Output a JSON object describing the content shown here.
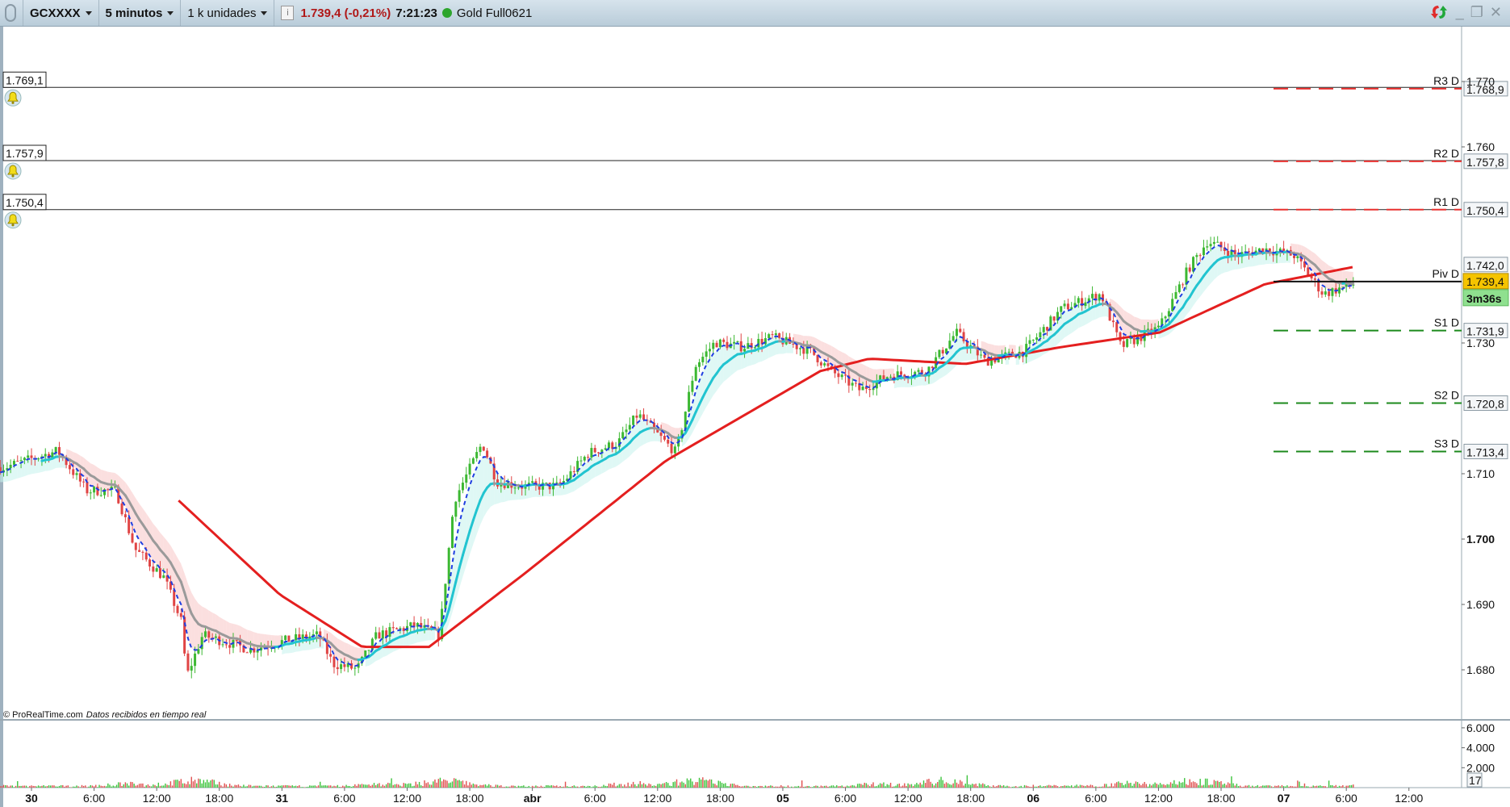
{
  "topbar": {
    "symbol": "GCXXXX",
    "timeframe": "5 minutos",
    "units": "1 k unidades",
    "info_icon": "i",
    "last_price": "1.739,4 (-0,21%)",
    "time": "7:21:23",
    "instrument": "Gold Full0621",
    "status_color": "#2da52d"
  },
  "window_controls": {
    "minimize": "_",
    "restore": "❐",
    "close": "✕"
  },
  "credit": {
    "source": "© ProRealTime.com",
    "note": "Datos recibidos en tiempo real"
  },
  "alerts": [
    {
      "label": "1.769,1",
      "price": 1769.1
    },
    {
      "label": "1.757,9",
      "price": 1757.9
    },
    {
      "label": "1.750,4",
      "price": 1750.4
    }
  ],
  "pivots": [
    {
      "name": "R3 D",
      "label": "1.768,9",
      "price": 1768.9,
      "color": "#e8312f",
      "style": "dash"
    },
    {
      "name": "R2 D",
      "label": "1.757,8",
      "price": 1757.8,
      "color": "#e8312f",
      "style": "dash"
    },
    {
      "name": "R1 D",
      "label": "1.750,4",
      "price": 1750.4,
      "color": "#e8312f",
      "style": "dash"
    },
    {
      "name": "Piv D",
      "label": "",
      "price": 1739.4,
      "color": "#111111",
      "style": "solid"
    },
    {
      "name": "S1 D",
      "label": "1.731,9",
      "price": 1731.9,
      "color": "#1c8a1c",
      "style": "dash"
    },
    {
      "name": "S2 D",
      "label": "1.720,8",
      "price": 1720.8,
      "color": "#1c8a1c",
      "style": "dash"
    },
    {
      "name": "S3 D",
      "label": "1.713,4",
      "price": 1713.4,
      "color": "#1c8a1c",
      "style": "dash"
    }
  ],
  "price_tags": {
    "ma_value": "1.742,0",
    "ma_price": 1742.0,
    "last": "1.739,4",
    "last_price": 1739.4,
    "countdown": "3m36s"
  },
  "price_axis": [
    {
      "label": "1.770",
      "value": 1770,
      "bold": false
    },
    {
      "label": "1.760",
      "value": 1760,
      "bold": false
    },
    {
      "label": "1.730",
      "value": 1730,
      "bold": false
    },
    {
      "label": "1.710",
      "value": 1710,
      "bold": false
    },
    {
      "label": "1.700",
      "value": 1700,
      "bold": true
    },
    {
      "label": "1.690",
      "value": 1690,
      "bold": false
    },
    {
      "label": "1.680",
      "value": 1680,
      "bold": false
    }
  ],
  "volume_axis": [
    {
      "label": "6.000",
      "value": 6000
    },
    {
      "label": "4.000",
      "value": 4000
    },
    {
      "label": "2.000",
      "value": 2000
    }
  ],
  "volume_last": "17",
  "time_axis": [
    {
      "label": "30",
      "hour": 0,
      "bold": true
    },
    {
      "label": "6:00",
      "hour": 6
    },
    {
      "label": "12:00",
      "hour": 12
    },
    {
      "label": "18:00",
      "hour": 18
    },
    {
      "label": "31",
      "hour": 24,
      "bold": true
    },
    {
      "label": "6:00",
      "hour": 30
    },
    {
      "label": "12:00",
      "hour": 36
    },
    {
      "label": "18:00",
      "hour": 42
    },
    {
      "label": "abr",
      "hour": 48,
      "bold": true
    },
    {
      "label": "6:00",
      "hour": 54
    },
    {
      "label": "12:00",
      "hour": 60
    },
    {
      "label": "18:00",
      "hour": 66
    },
    {
      "label": "05",
      "hour": 72,
      "bold": true
    },
    {
      "label": "6:00",
      "hour": 78
    },
    {
      "label": "12:00",
      "hour": 84
    },
    {
      "label": "18:00",
      "hour": 90
    },
    {
      "label": "06",
      "hour": 96,
      "bold": true
    },
    {
      "label": "6:00",
      "hour": 102
    },
    {
      "label": "12:00",
      "hour": 108
    },
    {
      "label": "18:00",
      "hour": 114
    },
    {
      "label": "07",
      "hour": 120,
      "bold": true
    },
    {
      "label": "6:00",
      "hour": 126
    },
    {
      "label": "12:00",
      "hour": 132
    }
  ],
  "chart_data": {
    "type": "candlestick",
    "price_path": [
      [
        -2.6,
        1711.0
      ],
      [
        2.5,
        1713.5
      ],
      [
        5.3,
        1707.4
      ],
      [
        8.1,
        1707.4
      ],
      [
        9.9,
        1698.5
      ],
      [
        12.7,
        1694.1
      ],
      [
        14.5,
        1686.8
      ],
      [
        14.8,
        1678.7
      ],
      [
        16.4,
        1685.3
      ],
      [
        21.0,
        1683.1
      ],
      [
        24.7,
        1684.6
      ],
      [
        27.5,
        1685.3
      ],
      [
        28.9,
        1680.9
      ],
      [
        31.2,
        1680.1
      ],
      [
        33.1,
        1685.3
      ],
      [
        36.8,
        1686.8
      ],
      [
        39.1,
        1685.3
      ],
      [
        40.5,
        1705.9
      ],
      [
        43.2,
        1714.7
      ],
      [
        44.6,
        1708.8
      ],
      [
        46.9,
        1708.1
      ],
      [
        50.6,
        1708.1
      ],
      [
        53.4,
        1713.2
      ],
      [
        56.2,
        1714.7
      ],
      [
        58.1,
        1719.1
      ],
      [
        60.8,
        1714.7
      ],
      [
        61.8,
        1713.2
      ],
      [
        63.6,
        1726.5
      ],
      [
        65.5,
        1730.1
      ],
      [
        68.2,
        1729.4
      ],
      [
        71.0,
        1730.9
      ],
      [
        74.7,
        1728.7
      ],
      [
        76.6,
        1725.7
      ],
      [
        79.4,
        1722.8
      ],
      [
        82.1,
        1725.0
      ],
      [
        85.8,
        1725.7
      ],
      [
        88.6,
        1731.6
      ],
      [
        91.4,
        1727.2
      ],
      [
        95.1,
        1728.7
      ],
      [
        98.8,
        1735.3
      ],
      [
        102.5,
        1737.5
      ],
      [
        104.4,
        1729.4
      ],
      [
        108.1,
        1732.4
      ],
      [
        110.8,
        1741.2
      ],
      [
        112.7,
        1745.6
      ],
      [
        115.5,
        1743.4
      ],
      [
        118.2,
        1744.4
      ],
      [
        121.0,
        1743.4
      ],
      [
        123.8,
        1737.5
      ],
      [
        126.6,
        1739.0
      ]
    ],
    "ma_path": [
      [
        14.1,
        1705.9
      ],
      [
        23.8,
        1691.5
      ],
      [
        31.7,
        1683.5
      ],
      [
        38.1,
        1683.5
      ],
      [
        47.4,
        1694.9
      ],
      [
        60.8,
        1712.0
      ],
      [
        75.6,
        1725.7
      ],
      [
        80.3,
        1727.6
      ],
      [
        89.5,
        1726.8
      ],
      [
        98.8,
        1729.4
      ],
      [
        108.1,
        1731.6
      ],
      [
        118.2,
        1739.0
      ],
      [
        126.6,
        1741.6
      ]
    ],
    "ylim": [
      1676,
      1772
    ],
    "volume_ylim": [
      0,
      6000
    ]
  }
}
